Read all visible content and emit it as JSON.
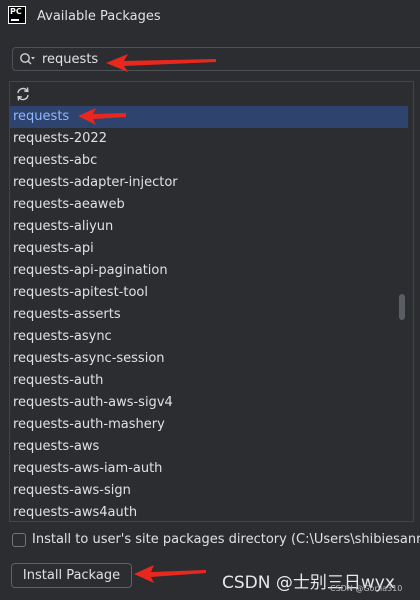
{
  "window": {
    "title": "Available Packages",
    "app_logo_text": "PC"
  },
  "search": {
    "value": "requests",
    "icon": "search-icon"
  },
  "list": {
    "refresh_icon": "refresh-icon",
    "selected_index": 0,
    "items": [
      "requests",
      "requests-2022",
      "requests-abc",
      "requests-adapter-injector",
      "requests-aeaweb",
      "requests-aliyun",
      "requests-api",
      "requests-api-pagination",
      "requests-apitest-tool",
      "requests-asserts",
      "requests-async",
      "requests-async-session",
      "requests-auth",
      "requests-auth-aws-sigv4",
      "requests-auth-mashery",
      "requests-aws",
      "requests-aws-iam-auth",
      "requests-aws-sign",
      "requests-aws4auth"
    ]
  },
  "options": {
    "user_site_label": "Install to user's site packages directory (C:\\Users\\shibiesanri_",
    "user_site_checked": false
  },
  "actions": {
    "install_label": "Install Package"
  },
  "watermark": {
    "main": "CSDN @士别三日wyx",
    "small": "CSDN @Gorlia310"
  },
  "colors": {
    "background": "#2b2d30",
    "selection": "#2e436e",
    "selected_text": "#8fb7ff",
    "annotation_arrow": "#e8281e"
  }
}
